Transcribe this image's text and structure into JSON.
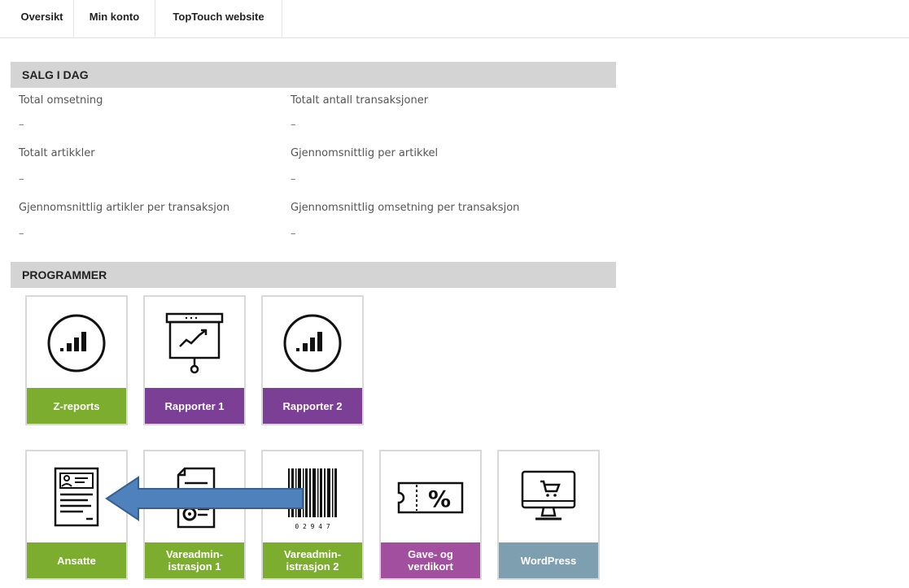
{
  "nav": {
    "tabs": [
      {
        "label": "Oversikt"
      },
      {
        "label": "Min konto"
      },
      {
        "label": "TopTouch website"
      }
    ]
  },
  "sales": {
    "title": "SALG I DAG",
    "stats": [
      {
        "label": "Total omsetning",
        "value": "–"
      },
      {
        "label": "Totalt antall transaksjoner",
        "value": "–"
      },
      {
        "label": "Totalt artikkler",
        "value": "–"
      },
      {
        "label": "Gjennomsnittlig per artikkel",
        "value": "–"
      },
      {
        "label": "Gjennomsnittlig artikler per transaksjon",
        "value": "–"
      },
      {
        "label": "Gjennomsnittlig omsetning per transaksjon",
        "value": "–"
      }
    ]
  },
  "programs": {
    "title": "PROGRAMMER",
    "tiles": [
      {
        "label": "Z-reports",
        "icon": "signal-gauge-icon",
        "color": "#7cad2e"
      },
      {
        "label": "Rapporter 1",
        "icon": "presentation-chart-icon",
        "color": "#7b3f95"
      },
      {
        "label": "Rapporter 2",
        "icon": "signal-gauge-icon",
        "color": "#7b3f95"
      },
      {
        "label": "Ansatte",
        "icon": "employee-id-card-icon",
        "color": "#7cad2e"
      },
      {
        "label": "Vareadmin-\nistrasjon 1",
        "icon": "document-gear-icon",
        "color": "#7cad2e"
      },
      {
        "label": "Vareadmin-\nistrasjon 2",
        "icon": "barcode-icon",
        "color": "#7cad2e"
      },
      {
        "label": "Gave- og\nverdikort",
        "icon": "discount-voucher-icon",
        "color": "#a24fa0"
      },
      {
        "label": "WordPress",
        "icon": "monitor-cart-icon",
        "color": "#7e9fb0"
      }
    ],
    "barcode_number": "0 2 9 4 7"
  },
  "colors": {
    "arrow_fill": "#4f81bd",
    "arrow_stroke": "#3a5f8c"
  }
}
